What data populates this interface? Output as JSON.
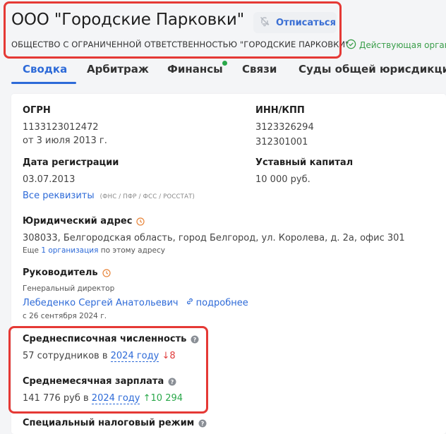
{
  "header": {
    "title": "ООО \"Городские Парковки\"",
    "unsubscribe_label": "Отписаться",
    "full_name": "ОБЩЕСТВО С ОГРАНИЧЕННОЙ ОТВЕТСТВЕННОСТЬЮ \"ГОРОДСКИЕ ПАРКОВКИ\"",
    "status": "Действующая органи"
  },
  "tabs": [
    {
      "label": "Сводка",
      "active": true
    },
    {
      "label": "Арбитраж"
    },
    {
      "label": "Финансы",
      "has_dot": true
    },
    {
      "label": "Связи"
    },
    {
      "label": "Суды общей юрисдикции"
    }
  ],
  "ogrn": {
    "label": "ОГРН",
    "value": "1133123012472",
    "date": "от 3 июля 2013 г."
  },
  "inn_kpp": {
    "label": "ИНН/КПП",
    "inn": "3123326294",
    "kpp": "312301001"
  },
  "registration": {
    "label": "Дата регистрации",
    "value": "03.07.2013"
  },
  "capital": {
    "label": "Уставный капитал",
    "value": "10 000 руб."
  },
  "requisites": {
    "link": "Все реквизиты",
    "note": "(ФНС / ПФР / ФСС / РОССТАТ)"
  },
  "address": {
    "label": "Юридический адрес",
    "value": "308033, Белгородская область, город Белгород, ул. Королева, д. 2а, офис 301",
    "more_prefix": "Еще",
    "more_link": "1 организация",
    "more_suffix": "по этому адресу"
  },
  "director": {
    "label": "Руководитель",
    "position": "Генеральный директор",
    "name": "Лебеденко Сергей Анатольевич",
    "details": "подробнее",
    "since": "с 26 сентября 2024 г."
  },
  "headcount": {
    "label": "Среднесписочная численность",
    "value": "57 сотрудников в",
    "year": "2024 году",
    "change": "↓8"
  },
  "salary": {
    "label": "Среднемесячная зарплата",
    "value": "141 776 руб в",
    "year": "2024 году",
    "change": "↑10 294"
  },
  "tax_regime": {
    "label": "Специальный налоговый режим"
  },
  "colors": {
    "accent": "#2d6ad8",
    "highlight": "#e53935",
    "positive": "#2aa84a",
    "negative": "#e03b3b"
  }
}
